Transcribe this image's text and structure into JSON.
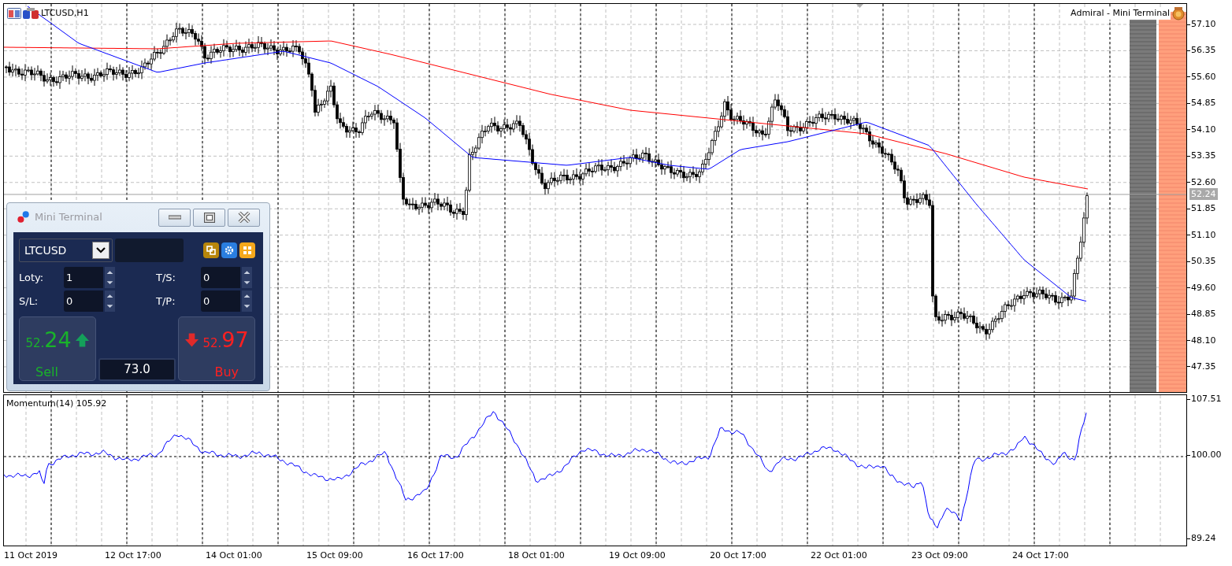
{
  "chart": {
    "title": "LTCUSD,H1",
    "label": "Admiral - Mini Terminal",
    "price_axis": [
      "57.10",
      "56.35",
      "55.60",
      "54.85",
      "54.10",
      "53.35",
      "52.60",
      "51.85",
      "51.10",
      "50.35",
      "49.60",
      "48.85",
      "48.10",
      "47.35"
    ],
    "current_price": "52.24"
  },
  "indicator": {
    "title": "Momentum(14) 105.92",
    "axis": [
      "107.51",
      "100.00",
      "89.24"
    ]
  },
  "time_axis": [
    "11 Oct 2019",
    "12 Oct 17:00",
    "14 Oct 01:00",
    "15 Oct 09:00",
    "16 Oct 17:00",
    "18 Oct 01:00",
    "19 Oct 09:00",
    "20 Oct 17:00",
    "22 Oct 01:00",
    "23 Oct 09:00",
    "24 Oct 17:00"
  ],
  "mini_terminal": {
    "title": "Mini Terminal",
    "symbol": "LTCUSD",
    "fields": [
      {
        "label": "Loty:",
        "value": "1"
      },
      {
        "label": "T/S:",
        "value": "0"
      },
      {
        "label": "S/L:",
        "value": "0"
      },
      {
        "label": "T/P:",
        "value": "0"
      }
    ],
    "sell": {
      "price_small": "52.",
      "price_big": "24",
      "label": "Sell"
    },
    "buy": {
      "price_small": "52.",
      "price_big": "97",
      "label": "Buy"
    },
    "spread": "73.0"
  }
}
